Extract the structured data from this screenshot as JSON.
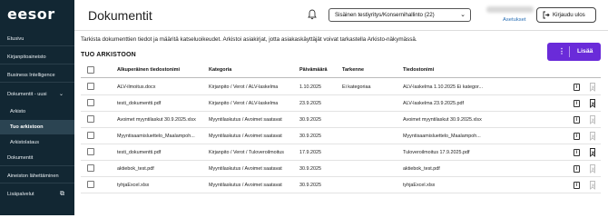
{
  "app": {
    "logo": "eesor",
    "page_title": "Dokumentit"
  },
  "sidebar": {
    "items": [
      {
        "label": "Etusivu"
      },
      {
        "label": "Kirjanpitoaineisto"
      },
      {
        "label": "Business Intelligence"
      },
      {
        "label": "Dokumentit - uusi",
        "chevron": "chevron-up"
      },
      {
        "label": "Arkisto"
      },
      {
        "label": "Tuo arkistoon",
        "active": true
      },
      {
        "label": "Arkistolataus"
      },
      {
        "label": "Dokumentit"
      },
      {
        "label": "Aineiston lähettäminen"
      },
      {
        "label": "Lisäpalvelut",
        "icon": "external-link-icon"
      }
    ]
  },
  "header": {
    "company_select": "Sisäinen testiyritys/Konsernihallinto (22)",
    "settings_link": "Asetukset",
    "logout_label": "Kirjaudu ulos"
  },
  "info_text": "Tarkista dokumenttien tiedot ja määritä katseluoikeudet. Arkistoi asiakirjat, jotta asiakaskäyttäjät voivat tarkastella Arkisto-näkymässä.",
  "section_title": "TUO ARKISTOON",
  "add_button": "Lisää",
  "table": {
    "headers": [
      "Alkuperäinen tiedostonimi",
      "Kategoria",
      "Päivämäärä",
      "Tarkenne",
      "Tiedostonimi"
    ],
    "rows": [
      [
        "ALV-ilmoitus.docx",
        "Kirjanpito / Verot / ALV-laskelma",
        "1.10.2025",
        "Ei kategoriaa",
        "ALV-laskelma 1.10.2025 Ei kategor..."
      ],
      [
        "testi_dokumentti.pdf",
        "Kirjanpito / Verot / ALV-laskelma",
        "23.9.2025",
        "",
        "ALV-laskelma 23.9.2025.pdf"
      ],
      [
        "Avoimet myyntilaskut 30.9.2025.xlsx",
        "Myyntilaskutus / Avoimet saatavat",
        "30.9.2025",
        "",
        "Avoimet myyntilaskut 30.9.2025.xlsx"
      ],
      [
        "Myyntisaamisluettelo_Maalampoh...",
        "Myyntilaskutus / Avoimet saatavat",
        "30.9.2025",
        "",
        "Myyntisaamisluettelo_Maalampoh..."
      ],
      [
        "testi_dokumentti.pdf",
        "Kirjanpito / Verot / Tuloveroilmoitus",
        "17.9.2025",
        "",
        "Tuloveroilmoitus 17.9.2025.pdf"
      ],
      [
        "aktiebok_test.pdf",
        "Myyntilaskutus / Avoimet saatavat",
        "30.9.2025",
        "",
        "aktiebok_test.pdf"
      ],
      [
        "tyhjaExcel.xlsx",
        "Myyntilaskutus / Avoimet saatavat",
        "30.9.2025",
        "",
        "tyhjaExcel.xlsx"
      ]
    ],
    "flag_active": [
      false,
      true,
      false,
      false,
      true,
      false,
      false
    ]
  },
  "colors": {
    "sidebar_bg": "#122733",
    "accent": "#6a2bd9",
    "link": "#2a6fb5"
  }
}
